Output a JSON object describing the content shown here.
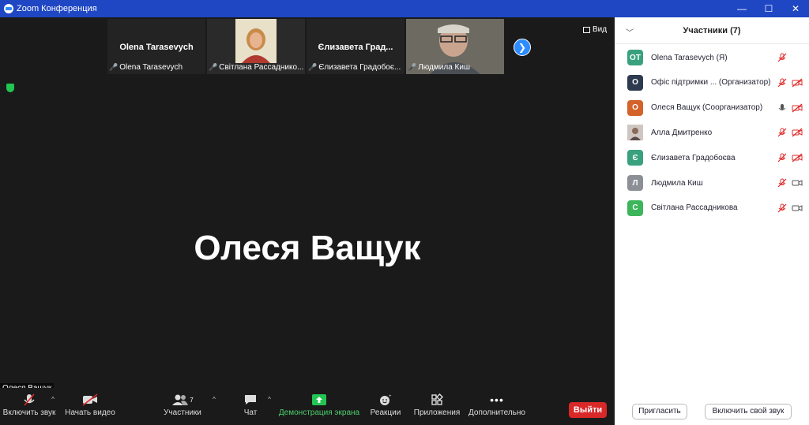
{
  "window": {
    "title": "Zoom Конференция",
    "controls": [
      "—",
      "☐",
      "✕"
    ]
  },
  "strip": {
    "tiles": [
      {
        "display": "Olena Tarasevych",
        "label": "Olena Tarasevych"
      },
      {
        "display": "",
        "label": "Світлана Рассаднико..."
      },
      {
        "display": "Єлизавета  Град...",
        "label": "Єлизавета Градобоє..."
      },
      {
        "display": "",
        "label": "Людмила Киш"
      }
    ],
    "next_icon": "chevron-right-icon",
    "view_label": "Вид"
  },
  "speaker": {
    "name": "Олеся Ващук",
    "badge": "Олеся Ващук"
  },
  "toolbar": {
    "audio": "Включить звук",
    "video": "Начать видео",
    "participants": "Участники",
    "participants_count": "7",
    "chat": "Чат",
    "share": "Демонстрация экрана",
    "reactions": "Реакции",
    "apps": "Приложения",
    "more": "Дополнительно",
    "leave": "Выйти"
  },
  "panel": {
    "title": "Участники (7)",
    "participants": [
      {
        "initials": "ОТ",
        "color": "#3aa17e",
        "name": "Olena Tarasevych (Я)",
        "mic": "muted",
        "cam": "none"
      },
      {
        "initials": "О",
        "color": "#2d3a4f",
        "name": "Офіс підтримки ...  (Организатор)",
        "mic": "muted",
        "cam": "off"
      },
      {
        "initials": "О",
        "color": "#d4622b",
        "name": "Олеся Ващук (Соорганизатор)",
        "mic": "on",
        "cam": "off"
      },
      {
        "initials": "",
        "color": "#8a7a7a",
        "name": "Алла Дмитренко",
        "mic": "muted",
        "cam": "off"
      },
      {
        "initials": "Є",
        "color": "#3aa17e",
        "name": "Єлизавета Градобоєва",
        "mic": "muted",
        "cam": "off"
      },
      {
        "initials": "Л",
        "color": "#8c8f95",
        "name": "Людмила Киш",
        "mic": "muted",
        "cam": "on"
      },
      {
        "initials": "С",
        "color": "#3db55b",
        "name": "Світлана Рассадникова",
        "mic": "muted",
        "cam": "on"
      }
    ],
    "invite": "Пригласить",
    "unmute_self": "Включить свой звук"
  }
}
